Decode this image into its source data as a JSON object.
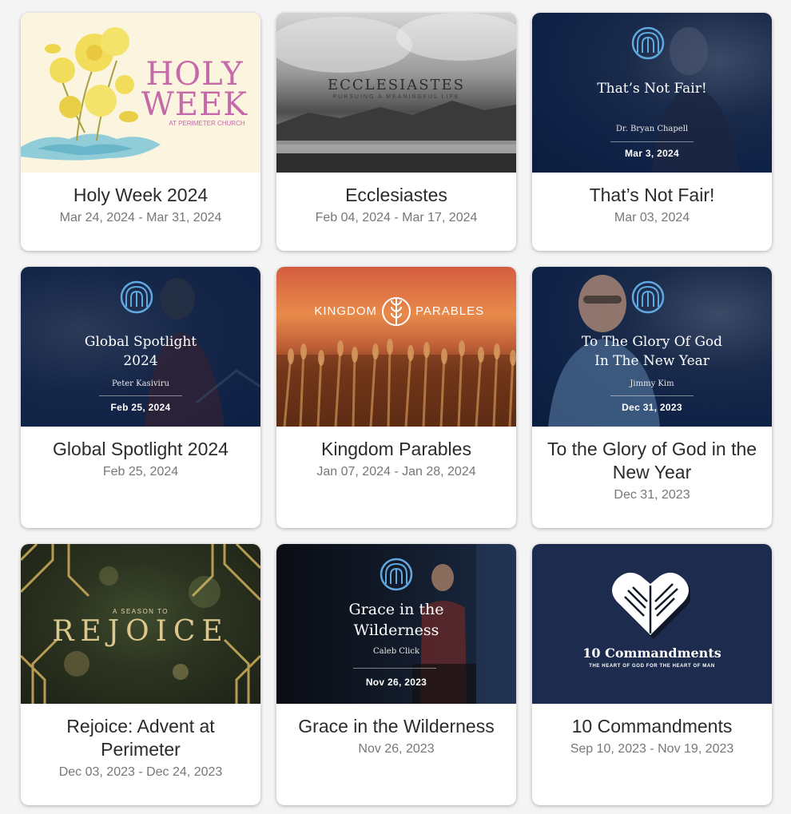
{
  "cards": [
    {
      "title": "Holy Week 2024",
      "dates": "Mar 24, 2024 - Mar 31, 2024",
      "image_text": {
        "line1": "HOLY",
        "line2": "WEEK",
        "sub": "AT PERIMETER CHURCH"
      }
    },
    {
      "title": "Ecclesiastes",
      "dates": "Feb 04, 2024 - Mar 17, 2024",
      "image_text": {
        "title": "ECCLESIASTES",
        "sub": "PURSUING A MEANINGFUL LIFE"
      }
    },
    {
      "title": "That’s Not Fair!",
      "dates": "Mar 03, 2024",
      "image_text": {
        "title": "That’s Not Fair!",
        "speaker": "Dr. Bryan Chapell",
        "date": "Mar 3, 2024"
      }
    },
    {
      "title": "Global Spotlight 2024",
      "dates": "Feb 25, 2024",
      "image_text": {
        "title1": "Global Spotlight",
        "title2": "2024",
        "speaker": "Peter Kasiviru",
        "date": "Feb 25, 2024"
      }
    },
    {
      "title": "Kingdom Parables",
      "dates": "Jan 07, 2024 - Jan 28, 2024",
      "image_text": {
        "left": "KINGDOM",
        "right": "PARABLES"
      }
    },
    {
      "title": "To the Glory of God in the New Year",
      "dates": "Dec 31, 2023",
      "image_text": {
        "title1": "To The Glory Of God",
        "title2": "In The New Year",
        "speaker": "Jimmy Kim",
        "date": "Dec 31, 2023"
      }
    },
    {
      "title": "Rejoice: Advent at Perimeter",
      "dates": "Dec 03, 2023 - Dec 24, 2023",
      "image_text": {
        "sub": "A SEASON TO",
        "title": "REJOICE"
      }
    },
    {
      "title": "Grace in the Wilderness",
      "dates": "Nov 26, 2023",
      "image_text": {
        "title1": "Grace in the",
        "title2": "Wilderness",
        "speaker": "Caleb Click",
        "date": "Nov 26, 2023"
      }
    },
    {
      "title": "10 Commandments",
      "dates": "Sep 10, 2023 - Nov 19, 2023",
      "image_text": {
        "title": "10 Commandments",
        "sub": "THE HEART OF GOD FOR THE HEART OF MAN"
      }
    }
  ],
  "colors": {
    "page_bg": "#f4f4f4",
    "card_bg": "#ffffff",
    "title_text": "#2b2b2b",
    "date_text": "#777777",
    "logo_blue": "#5fa8e0",
    "navy": "#0e2246"
  },
  "icons": [
    "church-arch-logo-icon",
    "wheat-icon",
    "bible-heart-icon"
  ]
}
